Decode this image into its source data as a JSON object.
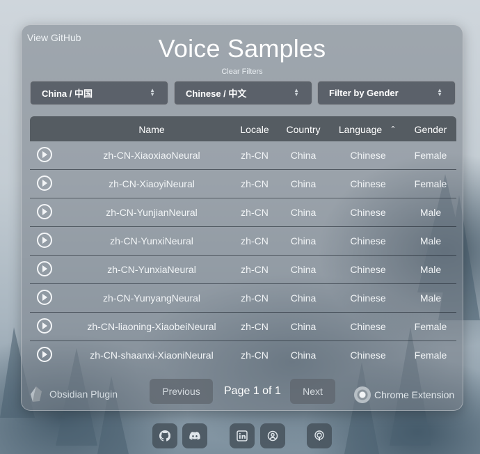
{
  "header": {
    "github_link": "View GitHub",
    "title": "Voice Samples",
    "clear_filters": "Clear Filters"
  },
  "filters": {
    "country": "China / 中国",
    "language": "Chinese / 中文",
    "gender": "Filter by Gender"
  },
  "table": {
    "columns": [
      "Name",
      "Locale",
      "Country",
      "Language",
      "Gender"
    ],
    "sorted_column": "Language",
    "sort_direction": "ascending",
    "rows": [
      {
        "name": "zh-CN-XiaoxiaoNeural",
        "locale": "zh-CN",
        "country": "China",
        "language": "Chinese",
        "gender": "Female"
      },
      {
        "name": "zh-CN-XiaoyiNeural",
        "locale": "zh-CN",
        "country": "China",
        "language": "Chinese",
        "gender": "Female"
      },
      {
        "name": "zh-CN-YunjianNeural",
        "locale": "zh-CN",
        "country": "China",
        "language": "Chinese",
        "gender": "Male"
      },
      {
        "name": "zh-CN-YunxiNeural",
        "locale": "zh-CN",
        "country": "China",
        "language": "Chinese",
        "gender": "Male"
      },
      {
        "name": "zh-CN-YunxiaNeural",
        "locale": "zh-CN",
        "country": "China",
        "language": "Chinese",
        "gender": "Male"
      },
      {
        "name": "zh-CN-YunyangNeural",
        "locale": "zh-CN",
        "country": "China",
        "language": "Chinese",
        "gender": "Male"
      },
      {
        "name": "zh-CN-liaoning-XiaobeiNeural",
        "locale": "zh-CN",
        "country": "China",
        "language": "Chinese",
        "gender": "Female"
      },
      {
        "name": "zh-CN-shaanxi-XiaoniNeural",
        "locale": "zh-CN",
        "country": "China",
        "language": "Chinese",
        "gender": "Female"
      }
    ]
  },
  "pagination": {
    "previous": "Previous",
    "page_info": "Page 1 of 1",
    "next": "Next"
  },
  "footer": {
    "obsidian": "Obsidian Plugin",
    "chrome": "Chrome Extension"
  },
  "social_icons": [
    "github-icon",
    "discord-icon",
    "linkedin-icon",
    "profile-icon",
    "podcast-icon"
  ]
}
